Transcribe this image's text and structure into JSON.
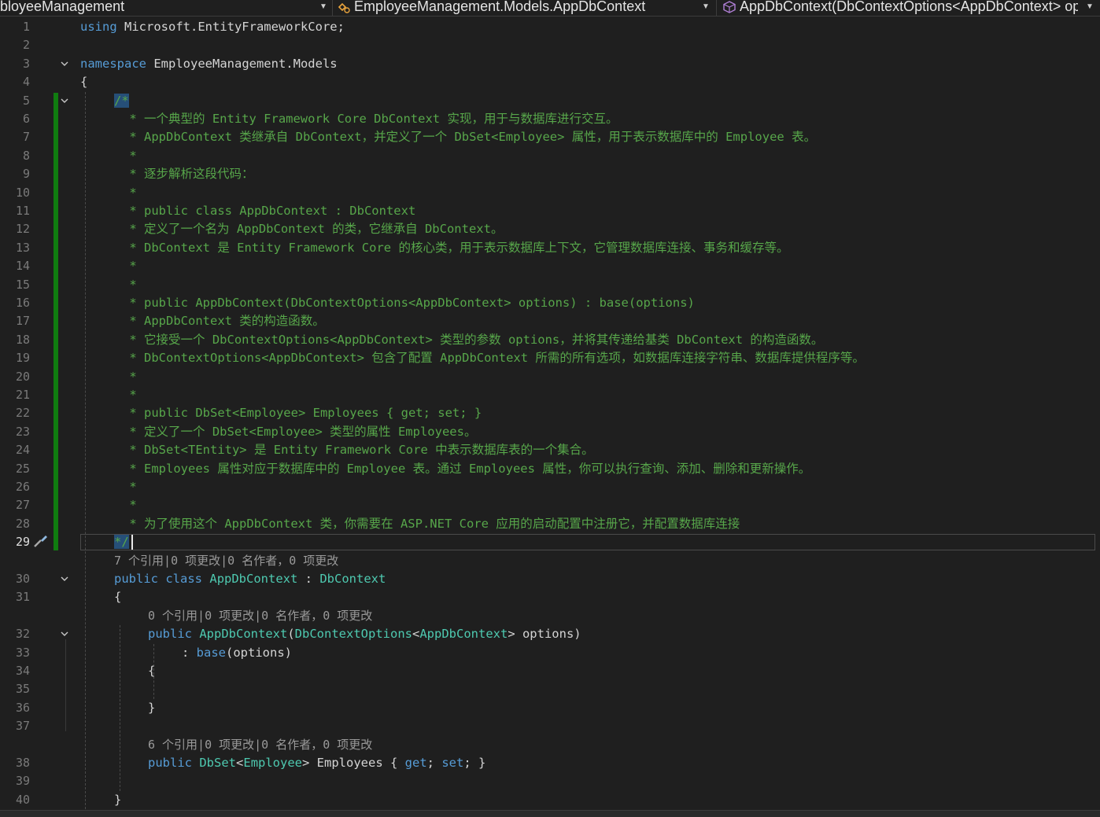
{
  "navbar": {
    "project": "bloyeeManagement",
    "type_scope": "EmployeeManagement.Models.AppDbContext",
    "member_scope": "AppDbContext(DbContextOptions<AppDbContext> options)",
    "type_icon": "class-icon",
    "member_icon": "method-cube-icon"
  },
  "lines": [
    {
      "n": "1",
      "tokens": [
        {
          "t": "using",
          "c": "kw"
        },
        {
          "t": " Microsoft.EntityFrameworkCore;",
          "c": ""
        }
      ]
    },
    {
      "n": "2",
      "tokens": []
    },
    {
      "n": "3",
      "tokens": [
        {
          "t": "namespace",
          "c": "kw"
        },
        {
          "t": " EmployeeManagement.Models",
          "c": ""
        }
      ]
    },
    {
      "n": "4",
      "tokens": [
        {
          "t": "{",
          "c": ""
        }
      ]
    },
    {
      "n": "5",
      "tokens": [
        {
          "t": "/*",
          "c": "sel"
        }
      ]
    },
    {
      "n": "6",
      "tokens": [
        {
          "t": " * 一个典型的 Entity Framework Core DbContext 实现，用于与数据库进行交互。",
          "c": "cm"
        }
      ]
    },
    {
      "n": "7",
      "tokens": [
        {
          "t": " * AppDbContext 类继承自 DbContext，并定义了一个 DbSet<Employee> 属性，用于表示数据库中的 Employee 表。",
          "c": "cm"
        }
      ]
    },
    {
      "n": "8",
      "tokens": [
        {
          "t": " *",
          "c": "cm"
        }
      ]
    },
    {
      "n": "9",
      "tokens": [
        {
          "t": " * 逐步解析这段代码：",
          "c": "cm"
        }
      ]
    },
    {
      "n": "10",
      "tokens": [
        {
          "t": " *",
          "c": "cm"
        }
      ]
    },
    {
      "n": "11",
      "tokens": [
        {
          "t": " * public class AppDbContext : DbContext",
          "c": "cm"
        }
      ]
    },
    {
      "n": "12",
      "tokens": [
        {
          "t": " * 定义了一个名为 AppDbContext 的类，它继承自 DbContext。",
          "c": "cm"
        }
      ]
    },
    {
      "n": "13",
      "tokens": [
        {
          "t": " * DbContext 是 Entity Framework Core 的核心类，用于表示数据库上下文，它管理数据库连接、事务和缓存等。",
          "c": "cm"
        }
      ]
    },
    {
      "n": "14",
      "tokens": [
        {
          "t": " *",
          "c": "cm"
        }
      ]
    },
    {
      "n": "15",
      "tokens": [
        {
          "t": " *",
          "c": "cm"
        }
      ]
    },
    {
      "n": "16",
      "tokens": [
        {
          "t": " * public AppDbContext(DbContextOptions<AppDbContext> options) : base(options)",
          "c": "cm"
        }
      ]
    },
    {
      "n": "17",
      "tokens": [
        {
          "t": " * AppDbContext 类的构造函数。",
          "c": "cm"
        }
      ]
    },
    {
      "n": "18",
      "tokens": [
        {
          "t": " * 它接受一个 DbContextOptions<AppDbContext> 类型的参数 options，并将其传递给基类 DbContext 的构造函数。",
          "c": "cm"
        }
      ]
    },
    {
      "n": "19",
      "tokens": [
        {
          "t": " * DbContextOptions<AppDbContext> 包含了配置 AppDbContext 所需的所有选项，如数据库连接字符串、数据库提供程序等。",
          "c": "cm"
        }
      ]
    },
    {
      "n": "20",
      "tokens": [
        {
          "t": " *",
          "c": "cm"
        }
      ]
    },
    {
      "n": "21",
      "tokens": [
        {
          "t": " *",
          "c": "cm"
        }
      ]
    },
    {
      "n": "22",
      "tokens": [
        {
          "t": " * public DbSet<Employee> Employees { get; set; }",
          "c": "cm"
        }
      ]
    },
    {
      "n": "23",
      "tokens": [
        {
          "t": " * 定义了一个 DbSet<Employee> 类型的属性 Employees。",
          "c": "cm"
        }
      ]
    },
    {
      "n": "24",
      "tokens": [
        {
          "t": " * DbSet<TEntity> 是 Entity Framework Core 中表示数据库表的一个集合。",
          "c": "cm"
        }
      ]
    },
    {
      "n": "25",
      "tokens": [
        {
          "t": " * Employees 属性对应于数据库中的 Employee 表。通过 Employees 属性，你可以执行查询、添加、删除和更新操作。",
          "c": "cm"
        }
      ]
    },
    {
      "n": "26",
      "tokens": [
        {
          "t": " *",
          "c": "cm"
        }
      ]
    },
    {
      "n": "27",
      "tokens": [
        {
          "t": " *",
          "c": "cm"
        }
      ]
    },
    {
      "n": "28",
      "tokens": [
        {
          "t": " * 为了使用这个 AppDbContext 类，你需要在 ASP.NET Core 应用的启动配置中注册它，并配置数据库连接",
          "c": "cm"
        }
      ]
    },
    {
      "n": "29",
      "tokens": [
        {
          "t": "*/",
          "c": "sel"
        }
      ]
    },
    {
      "n": "30",
      "tokens": [
        {
          "t": "public",
          "c": "kw"
        },
        {
          "t": " ",
          "c": ""
        },
        {
          "t": "class",
          "c": "kw"
        },
        {
          "t": " ",
          "c": ""
        },
        {
          "t": "AppDbContext",
          "c": "ty"
        },
        {
          "t": " : ",
          "c": ""
        },
        {
          "t": "DbContext",
          "c": "ty"
        }
      ]
    },
    {
      "n": "31",
      "tokens": [
        {
          "t": "{",
          "c": ""
        }
      ]
    },
    {
      "n": "32",
      "tokens": [
        {
          "t": "public",
          "c": "kw"
        },
        {
          "t": " ",
          "c": ""
        },
        {
          "t": "AppDbContext",
          "c": "ty"
        },
        {
          "t": "(",
          "c": ""
        },
        {
          "t": "DbContextOptions",
          "c": "ty"
        },
        {
          "t": "<",
          "c": ""
        },
        {
          "t": "AppDbContext",
          "c": "ty"
        },
        {
          "t": "> options)",
          "c": ""
        }
      ]
    },
    {
      "n": "33",
      "tokens": [
        {
          "t": ": ",
          "c": ""
        },
        {
          "t": "base",
          "c": "kw"
        },
        {
          "t": "(options)",
          "c": ""
        }
      ]
    },
    {
      "n": "34",
      "tokens": [
        {
          "t": "{",
          "c": ""
        }
      ]
    },
    {
      "n": "35",
      "tokens": []
    },
    {
      "n": "36",
      "tokens": [
        {
          "t": "}",
          "c": ""
        }
      ]
    },
    {
      "n": "37",
      "tokens": []
    },
    {
      "n": "38",
      "tokens": [
        {
          "t": "public",
          "c": "kw"
        },
        {
          "t": " ",
          "c": ""
        },
        {
          "t": "DbSet",
          "c": "ty"
        },
        {
          "t": "<",
          "c": ""
        },
        {
          "t": "Employee",
          "c": "ty"
        },
        {
          "t": "> Employees { ",
          "c": ""
        },
        {
          "t": "get",
          "c": "kw"
        },
        {
          "t": "; ",
          "c": ""
        },
        {
          "t": "set",
          "c": "kw"
        },
        {
          "t": "; }",
          "c": ""
        }
      ]
    },
    {
      "n": "39",
      "tokens": []
    },
    {
      "n": "40",
      "tokens": [
        {
          "t": "}",
          "c": ""
        }
      ]
    }
  ],
  "codelens": {
    "class_refs": "7 个引用|0 项更改|0 名作者，0 项更改",
    "ctor_refs": "0 个引用|0 项更改|0 名作者，0 项更改",
    "prop_refs": "6 个引用|0 项更改|0 名作者，0 项更改"
  },
  "current_line": "29"
}
